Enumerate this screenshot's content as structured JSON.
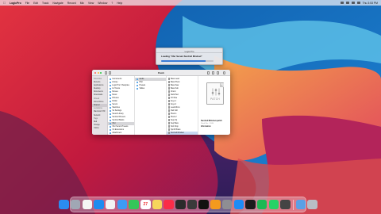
{
  "menubar": {
    "app_name": "LogicPro",
    "items": [
      "File",
      "Edit",
      "Track",
      "Navigate",
      "Record",
      "Mix",
      "View",
      "Window",
      "?",
      "Help"
    ],
    "clock": "Thu 3:53 PM"
  },
  "dialog": {
    "title": "Logic Pro",
    "message": "Loading \"Xfer Serum SunCell Mindset\"",
    "progress": 0.85
  },
  "finder": {
    "title": "Patch",
    "sidebar": [
      {
        "label": "Favorites",
        "header": true
      },
      {
        "label": "Recents"
      },
      {
        "label": "Applications"
      },
      {
        "label": "Desktop"
      },
      {
        "label": "Documents"
      },
      {
        "label": "Downloads"
      },
      {
        "label": "iCloud",
        "header": true
      },
      {
        "label": "iCloud Drive"
      },
      {
        "label": "Shared",
        "selected": true
      },
      {
        "label": "Locations",
        "header": true
      },
      {
        "label": "Macintosh HD"
      },
      {
        "label": "Network"
      },
      {
        "label": "Tags",
        "header": true
      },
      {
        "label": "Red"
      },
      {
        "label": "Orange"
      },
      {
        "label": "Yellow"
      }
    ],
    "column1": [
      {
        "label": "Instruments"
      },
      {
        "label": "Library"
      },
      {
        "label": "Logic Pro X Samples"
      },
      {
        "label": "LUT-Lists"
      },
      {
        "label": "Movies"
      },
      {
        "label": "Music"
      },
      {
        "label": "Pictures"
      },
      {
        "label": "Public"
      },
      {
        "label": "Serum"
      },
      {
        "label": "Sketches"
      },
      {
        "label": "SL Settings"
      },
      {
        "label": "Sound Library"
      },
      {
        "label": "SunCell Presets"
      },
      {
        "label": "SunCell Banks"
      },
      {
        "label": "Xfer",
        "selected": true
      },
      {
        "label": "Xfer Serum Presets"
      },
      {
        "label": "XL Extensions"
      },
      {
        "label": "Attachment"
      },
      {
        "label": "Unused Presets"
      },
      {
        "label": ""
      },
      {
        "label": "Logic Studio"
      }
    ],
    "column2": [
      {
        "label": "Audio",
        "selected": true
      },
      {
        "label": "Plist"
      },
      {
        "label": "Presets"
      },
      {
        "label": "Tables"
      }
    ],
    "column3": [
      "Bass Lead",
      "Bass Pluck",
      "Bass Saw",
      "Bass Sub",
      "Chord",
      "Dark Pad",
      "FX Rise",
      "Keys 1",
      "Keys 2",
      "Lead Mono",
      "Pad Soft",
      "Pluck 1",
      "Pluck 2",
      "Seq Arp",
      "Seq Bass",
      "Sub Drop",
      "Synth Brass",
      "SunCell Mindset",
      "Vocal Chop",
      "Wide Pad"
    ],
    "column3_selected_index": 17,
    "preview": {
      "icon_label": "PATCH",
      "name": "SunCell Mindset.patch",
      "kind": "Patch File - 11 KB",
      "info_heading": "Information"
    }
  },
  "dock": {
    "apps": [
      {
        "name": "Finder",
        "color": "#2b8cf0",
        "icon": "finder-icon"
      },
      {
        "name": "Launchpad",
        "color": "#a0a7b4",
        "icon": "launchpad-icon"
      },
      {
        "name": "Chrome",
        "color": "#f5f5f5",
        "icon": "chrome-icon"
      },
      {
        "name": "Safari",
        "color": "#1d8bf0",
        "icon": "safari-icon"
      },
      {
        "name": "Photos",
        "color": "#f3f3f3",
        "icon": "photos-icon"
      },
      {
        "name": "Mail",
        "color": "#3d9bf5",
        "icon": "mail-icon"
      },
      {
        "name": "Messages",
        "color": "#34c759",
        "icon": "messages-icon"
      },
      {
        "name": "Calendar",
        "color": "#ffffff",
        "icon": "calendar-icon",
        "text": "27"
      },
      {
        "name": "Notes",
        "color": "#f6d55c",
        "icon": "notes-icon"
      },
      {
        "name": "Music",
        "color": "#fa2d48",
        "icon": "music-icon"
      },
      {
        "name": "Final Cut",
        "color": "#2b2b2b",
        "icon": "finalcut-icon"
      },
      {
        "name": "Logic Pro",
        "color": "#3a3a3a",
        "icon": "logic-icon"
      },
      {
        "name": "TV",
        "color": "#111111",
        "icon": "tv-icon"
      },
      {
        "name": "Pages",
        "color": "#f39a1e",
        "icon": "pages-icon"
      },
      {
        "name": "Settings",
        "color": "#8e8e93",
        "icon": "settings-icon"
      },
      {
        "name": "App Store",
        "color": "#1d8cf6",
        "icon": "appstore-icon"
      },
      {
        "name": "Terminal",
        "color": "#1c1c1c",
        "icon": "terminal-icon"
      },
      {
        "name": "Spotify",
        "color": "#1db954",
        "icon": "spotify-icon"
      },
      {
        "name": "WhatsApp",
        "color": "#25d366",
        "icon": "whatsapp-icon"
      },
      {
        "name": "Activity",
        "color": "#444444",
        "icon": "activity-icon"
      }
    ],
    "right": [
      {
        "name": "Downloads",
        "color": "#5aa0e6",
        "icon": "downloads-folder-icon"
      },
      {
        "name": "Trash",
        "color": "#b8bdc6",
        "icon": "trash-icon"
      }
    ]
  }
}
